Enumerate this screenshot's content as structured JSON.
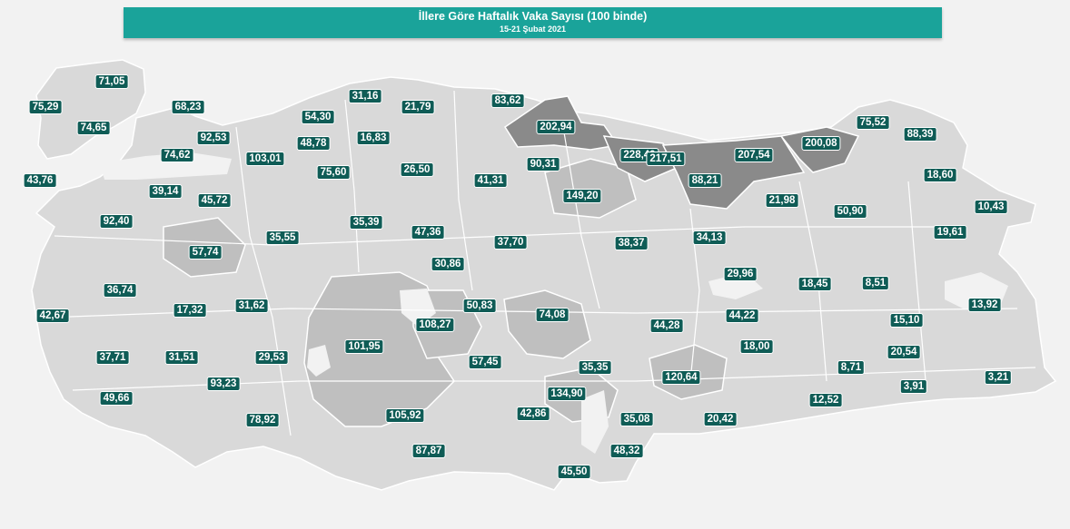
{
  "header": {
    "title": "İllere Göre Haftalık Vaka Sayısı (100 binde)",
    "subtitle": "15-21 Şubat 2021"
  },
  "colors": {
    "title_bar": "#1aa39a",
    "label_bg": "#0f5c56",
    "land_low": "#d9d9d9",
    "land_mid": "#bfbfbf",
    "land_high": "#8a8a8a",
    "border": "#ffffff",
    "background": "#f2f2f2"
  },
  "labels": [
    "71,05",
    "75,29",
    "68,23",
    "74,65",
    "92,53",
    "54,30",
    "31,16",
    "21,79",
    "83,62",
    "202,94",
    "228,40",
    "217,51",
    "207,54",
    "200,08",
    "75,52",
    "88,39",
    "43,76",
    "74,62",
    "103,01",
    "48,78",
    "16,83",
    "75,60",
    "26,50",
    "41,31",
    "90,31",
    "88,21",
    "18,60",
    "39,14",
    "45,72",
    "149,20",
    "21,98",
    "50,90",
    "10,43",
    "92,40",
    "35,39",
    "47,36",
    "35,55",
    "37,70",
    "38,37",
    "34,13",
    "19,61",
    "57,74",
    "30,86",
    "29,96",
    "36,74",
    "18,45",
    "8,51",
    "17,32",
    "31,62",
    "50,83",
    "74,08",
    "13,92",
    "42,67",
    "108,27",
    "44,28",
    "44,22",
    "15,10",
    "101,95",
    "18,00",
    "37,71",
    "31,51",
    "29,53",
    "57,45",
    "35,35",
    "20,54",
    "8,71",
    "93,23",
    "134,90",
    "120,64",
    "3,21",
    "49,66",
    "3,91",
    "12,52",
    "42,86",
    "35,08",
    "20,42",
    "105,92",
    "78,92",
    "87,87",
    "48,32",
    "45,50"
  ]
}
